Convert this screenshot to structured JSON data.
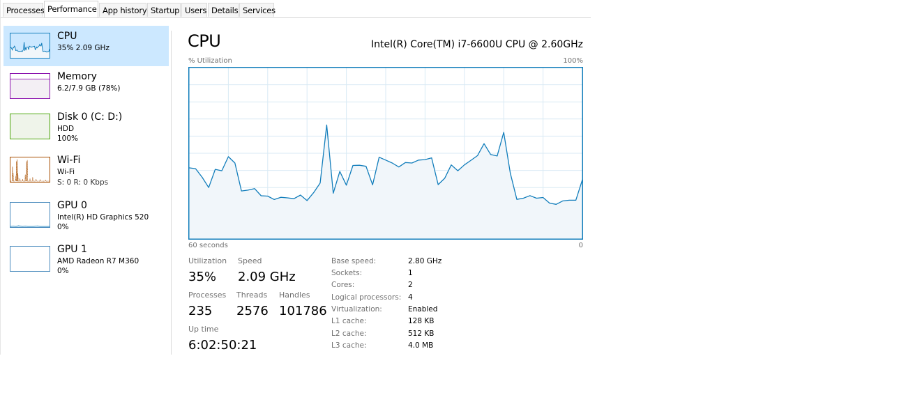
{
  "tabs": [
    {
      "label": "Processes",
      "active": false
    },
    {
      "label": "Performance",
      "active": true
    },
    {
      "label": "App history",
      "active": false
    },
    {
      "label": "Startup",
      "active": false
    },
    {
      "label": "Users",
      "active": false
    },
    {
      "label": "Details",
      "active": false
    },
    {
      "label": "Services",
      "active": false
    }
  ],
  "sidebar": {
    "items": [
      {
        "title": "CPU",
        "sub1": "35%  2.09 GHz",
        "sub2": "",
        "selected": true,
        "icon": "cpu-graph-icon",
        "color": "#117dbb"
      },
      {
        "title": "Memory",
        "sub1": "6.2/7.9 GB (78%)",
        "sub2": "",
        "selected": false,
        "icon": "memory-graph-icon",
        "color": "#8b12ae"
      },
      {
        "title": "Disk 0 (C: D:)",
        "sub1": "HDD",
        "sub2": "100%",
        "selected": false,
        "icon": "disk-graph-icon",
        "color": "#4da60c"
      },
      {
        "title": "Wi-Fi",
        "sub1": "Wi-Fi",
        "sub2": "S: 0  R: 0 Kbps",
        "selected": false,
        "icon": "wifi-graph-icon",
        "color": "#a74f01"
      },
      {
        "title": "GPU 0",
        "sub1": "Intel(R) HD Graphics 520",
        "sub2": "0%",
        "selected": false,
        "icon": "gpu0-graph-icon",
        "color": "#117dbb"
      },
      {
        "title": "GPU 1",
        "sub1": "AMD Radeon R7 M360",
        "sub2": "0%",
        "selected": false,
        "icon": "gpu1-graph-icon",
        "color": "#117dbb"
      }
    ]
  },
  "main": {
    "title": "CPU",
    "model": "Intel(R) Core(TM) i7-6600U CPU @ 2.60GHz",
    "stats": {
      "utilization_label": "Utilization",
      "utilization_value": "35%",
      "speed_label": "Speed",
      "speed_value": "2.09 GHz",
      "processes_label": "Processes",
      "processes_value": "235",
      "threads_label": "Threads",
      "threads_value": "2576",
      "handles_label": "Handles",
      "handles_value": "101786",
      "uptime_label": "Up time",
      "uptime_value": "6:02:50:21"
    },
    "specs": [
      {
        "label": "Base speed:",
        "value": "2.80 GHz"
      },
      {
        "label": "Sockets:",
        "value": "1"
      },
      {
        "label": "Cores:",
        "value": "2"
      },
      {
        "label": "Logical processors:",
        "value": "4"
      },
      {
        "label": "Virtualization:",
        "value": "Enabled"
      },
      {
        "label": "L1 cache:",
        "value": "128 KB"
      },
      {
        "label": "L2 cache:",
        "value": "512 KB"
      },
      {
        "label": "L3 cache:",
        "value": "4.0 MB"
      }
    ]
  },
  "colors": {
    "cpu_line": "#117dbb",
    "cpu_fill": "#f1f6fa",
    "grid": "#d9eaf4",
    "selected_bg": "#cce8ff"
  },
  "chart_data": {
    "type": "area",
    "title": "CPU",
    "ylabel": "% Utilization",
    "ymax_label": "100%",
    "xlabel": "60 seconds",
    "xmin_label": "0",
    "ylim": [
      0,
      100
    ],
    "xlim": [
      60,
      0
    ],
    "grid": true,
    "grid_rows": 10,
    "grid_cols": 10,
    "series": [
      {
        "name": "% Utilization",
        "x_seconds_ago": [
          60,
          59,
          58,
          57,
          56,
          55,
          54,
          53,
          52,
          51,
          50,
          49,
          48,
          47,
          46,
          45,
          44,
          43,
          42,
          41,
          40,
          39,
          38,
          37,
          36,
          35,
          34,
          33,
          32,
          31,
          30,
          29,
          28,
          27,
          26,
          25,
          24,
          23,
          22,
          21,
          20,
          19,
          18,
          17,
          16,
          15,
          14,
          13,
          12,
          11,
          10,
          9,
          8,
          7,
          6,
          5,
          4,
          3,
          2,
          1,
          0
        ],
        "values": [
          41.5,
          41,
          36,
          30,
          40.6,
          39.8,
          48,
          44.3,
          28,
          28.5,
          29.4,
          25.2,
          25,
          23,
          24.3,
          24,
          23.5,
          25.6,
          22.4,
          27,
          32.6,
          66.5,
          26.7,
          39.4,
          31.4,
          42.9,
          43,
          42.4,
          31.6,
          47.7,
          46,
          44.3,
          42,
          44.6,
          44.3,
          46,
          46.3,
          47.3,
          31.7,
          35.4,
          43.2,
          39.8,
          43.2,
          45.9,
          48.6,
          55.6,
          49.3,
          48.4,
          62.2,
          38.5,
          23.1,
          23.8,
          25.3,
          23.8,
          24.2,
          20.9,
          20.2,
          22.2,
          22.6,
          22.6,
          34.6
        ]
      }
    ]
  }
}
